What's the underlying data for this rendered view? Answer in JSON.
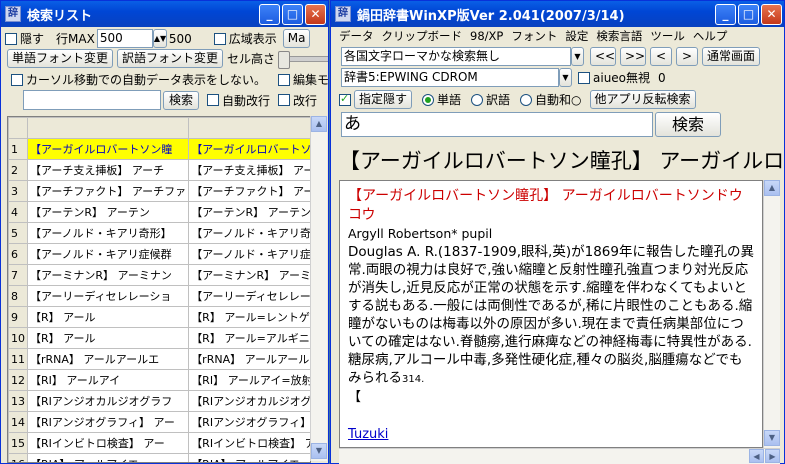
{
  "search_window": {
    "title": "検索リスト",
    "hide_label": "隠す",
    "max_rows_label": "行MAX",
    "max_rows_value": "500",
    "max_rows_display": "500",
    "wide_display_label": "広域表示",
    "ma_button": "Ma",
    "word_font_button": "単語フォント変更",
    "trans_font_button": "訳語フォント変更",
    "cell_height_label": "セル高さ",
    "auto_data_label": "カーソル移動での自動データ表示をしない。",
    "edit_mode_label": "編集モード",
    "search_button": "検索",
    "auto_wrap_label": "自動改行",
    "wrap2_label": "改行",
    "rows": [
      {
        "num": "1",
        "c1": "【アーガイルロバートソン瞳",
        "c2": "【アーガイルロバートソン瞳孔】"
      },
      {
        "num": "2",
        "c1": "【アーチ支え挿板】 アーチ",
        "c2": "【アーチ支え挿板】 アーチサポ"
      },
      {
        "num": "3",
        "c1": "【アーチファクト】 アーチファ",
        "c2": "【アーチファクト】 アーチファクト"
      },
      {
        "num": "4",
        "c1": "【アーテンR】 アーテン",
        "c2": "【アーテンR】 アーテン→トリヘ"
      },
      {
        "num": "5",
        "c1": "【アーノルド・キアリ奇形】",
        "c2": "【アーノルド・キアリ奇形】 アー"
      },
      {
        "num": "6",
        "c1": "【アーノルド・キアリ症候群",
        "c2": "【アーノルド・キアリ症候群】 ア"
      },
      {
        "num": "7",
        "c1": "【アーミナンR】 アーミナン",
        "c2": "【アーミナンR】 アーミナン→エ"
      },
      {
        "num": "8",
        "c1": "【アーリーディセレレーショ",
        "c2": "【アーリーディセレレーション】"
      },
      {
        "num": "9",
        "c1": "【R】 アール",
        "c2": "【R】 アール=レントゲン【"
      },
      {
        "num": "10",
        "c1": "【R】 アール",
        "c2": "【R】 アール=アルギニン【"
      },
      {
        "num": "11",
        "c1": "【rRNA】 アールアールエ",
        "c2": "【rRNA】 アールアールエヌエー"
      },
      {
        "num": "12",
        "c1": "【RI】 アールアイ",
        "c2": "【RI】 アールアイ=放射性同位"
      },
      {
        "num": "13",
        "c1": "【RIアンジオカルジオグラフ",
        "c2": "【RIアンジオカルジオグラフィ】"
      },
      {
        "num": "14",
        "c1": "【RIアンジオグラフィ】 アー",
        "c2": "【RIアンジオグラフィ】 アールア"
      },
      {
        "num": "15",
        "c1": "【RIインビトロ検査】 アー",
        "c2": "【RIインビトロ検査】 アールアイ"
      },
      {
        "num": "16",
        "c1": "【RIA】 アールアイエー",
        "c2": "【RIA】 アールアイエー=ラジオ"
      }
    ]
  },
  "main_window": {
    "title": "鍋田辞書WinXP版Ver 2.041(2007/3/14)",
    "menu": [
      "データ",
      "クリップボード",
      "98/XP",
      "フォント",
      "設定",
      "検索言語",
      "ツール",
      "ヘルプ"
    ],
    "search_mode": "各国文字ローマかな検索無し",
    "nav_buttons": [
      "<<",
      ">>",
      "<",
      ">"
    ],
    "normal_view_button": "通常画面",
    "dictionary": "辞書5:EPWING CDROM",
    "aiueo_label": "aiueo無視",
    "aiueo_count": "0",
    "hide_spec_label": "指定隠す",
    "word_radio": "単語",
    "trans_radio": "訳語",
    "auto_radio": "自動和○",
    "other_app_button": "他アプリ反転検索",
    "query": "あ",
    "search_button": "検索",
    "headline": "【アーガイルロバートソン瞳孔】 アーガイルロバー",
    "entry_head_word": "【アーガイルロバートソン瞳孔】",
    "entry_reading": "アーガイルロバートソンドウコウ",
    "entry_english": "Argyll Robertson* pupil",
    "entry_body": "Douglas A. R.(1837-1909,眼科,英)が1869年に報告した瞳孔の異常.両眼の視力は良好で,強い縮瞳と反射性瞳孔強直つまり対光反応が消失し,近見反応が正常の状態を示す.縮瞳を伴わなくてもよいとする説もある.一般には両側性であるが,稀に片眼性のこともある.縮瞳がないものは梅毒以外の原因が多い.現在まで責任病巣部位についての確定はない.脊髄癆,進行麻痺などの神経梅毒に特異性がある.糖尿病,アルコール中毒,多発性硬化症,種々の脳炎,脳腫瘍などでもみられる",
    "entry_page": "314.",
    "entry_bracket": "【",
    "link": "Tuzuki",
    "colors": {
      "headword": "#cc0000",
      "link": "#0000cc"
    }
  }
}
